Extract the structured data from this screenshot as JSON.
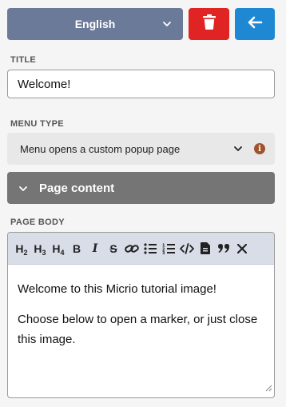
{
  "language_select": {
    "value": "English"
  },
  "title_field": {
    "label": "Title",
    "value": "Welcome!"
  },
  "menu_type": {
    "label": "Menu type",
    "value": "Menu opens a custom popup page"
  },
  "section": {
    "label": "Page content"
  },
  "page_body": {
    "label": "Page body",
    "toolbar": {
      "h2": "H2",
      "h3": "H3",
      "h4": "H4",
      "bold": "B",
      "italic": "I",
      "strike": "S"
    },
    "paragraphs": [
      "Welcome to this Micrio tutorial image!",
      "Choose below to open a marker, or just close this image."
    ]
  },
  "colors": {
    "language_bg": "#6b7a99",
    "delete_bg": "#e02424",
    "back_bg": "#1e88d2",
    "section_bg": "#757575",
    "toolbar_bg": "#d8dde8",
    "info_icon": "#a0522d"
  },
  "icons": [
    "chevron-down-icon",
    "trash-icon",
    "arrow-left-icon",
    "info-icon",
    "link-icon",
    "bullet-list-icon",
    "numbered-list-icon",
    "code-icon",
    "file-icon",
    "quote-icon",
    "close-icon",
    "resize-handle-icon"
  ]
}
